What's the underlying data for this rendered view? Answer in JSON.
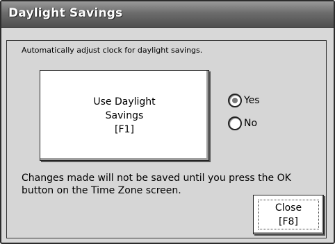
{
  "window": {
    "title": "Daylight Savings"
  },
  "description": "Automatically adjust clock for daylight savings.",
  "daylight_button": {
    "label": "Use Daylight\nSavings\n[F1]"
  },
  "options": {
    "yes": {
      "label": "Yes",
      "selected": true
    },
    "no": {
      "label": "No",
      "selected": false
    }
  },
  "note": "Changes made will not be saved until you press the OK button on the Time Zone screen.",
  "close_button": {
    "label": "Close\n[F8]"
  }
}
